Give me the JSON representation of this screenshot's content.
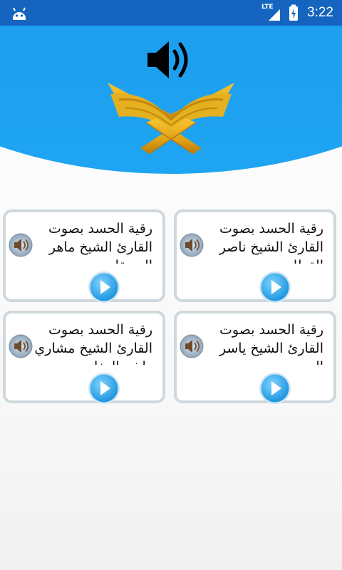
{
  "status_bar": {
    "network_label": "LTE",
    "time": "3:22",
    "icons": [
      "android-icon",
      "signal-icon",
      "battery-charging-icon"
    ]
  },
  "header": {
    "icons": [
      "speaker-volume-icon",
      "quran-book-icon"
    ]
  },
  "cards": [
    {
      "title": "رقية الحسد بصوت القارئ الشيخ ناصر القطامي",
      "icons": [
        "speaker-icon",
        "play-icon"
      ]
    },
    {
      "title": "رقية الحسد بصوت القارئ الشيخ ماهر المعيقلي",
      "icons": [
        "speaker-icon",
        "play-icon"
      ]
    },
    {
      "title": "رقية الحسد بصوت القارئ الشيخ ياسر الدوسري",
      "icons": [
        "speaker-icon",
        "play-icon"
      ]
    },
    {
      "title": "رقية الحسد بصوت القارئ الشيخ مشاري راشد العفاسي",
      "icons": [
        "speaker-icon",
        "play-icon"
      ]
    }
  ],
  "colors": {
    "status_bar": "#1565c0",
    "header": "#1b9bef",
    "card_border": "#cfd8dc",
    "play_button": "#29a8ee"
  }
}
